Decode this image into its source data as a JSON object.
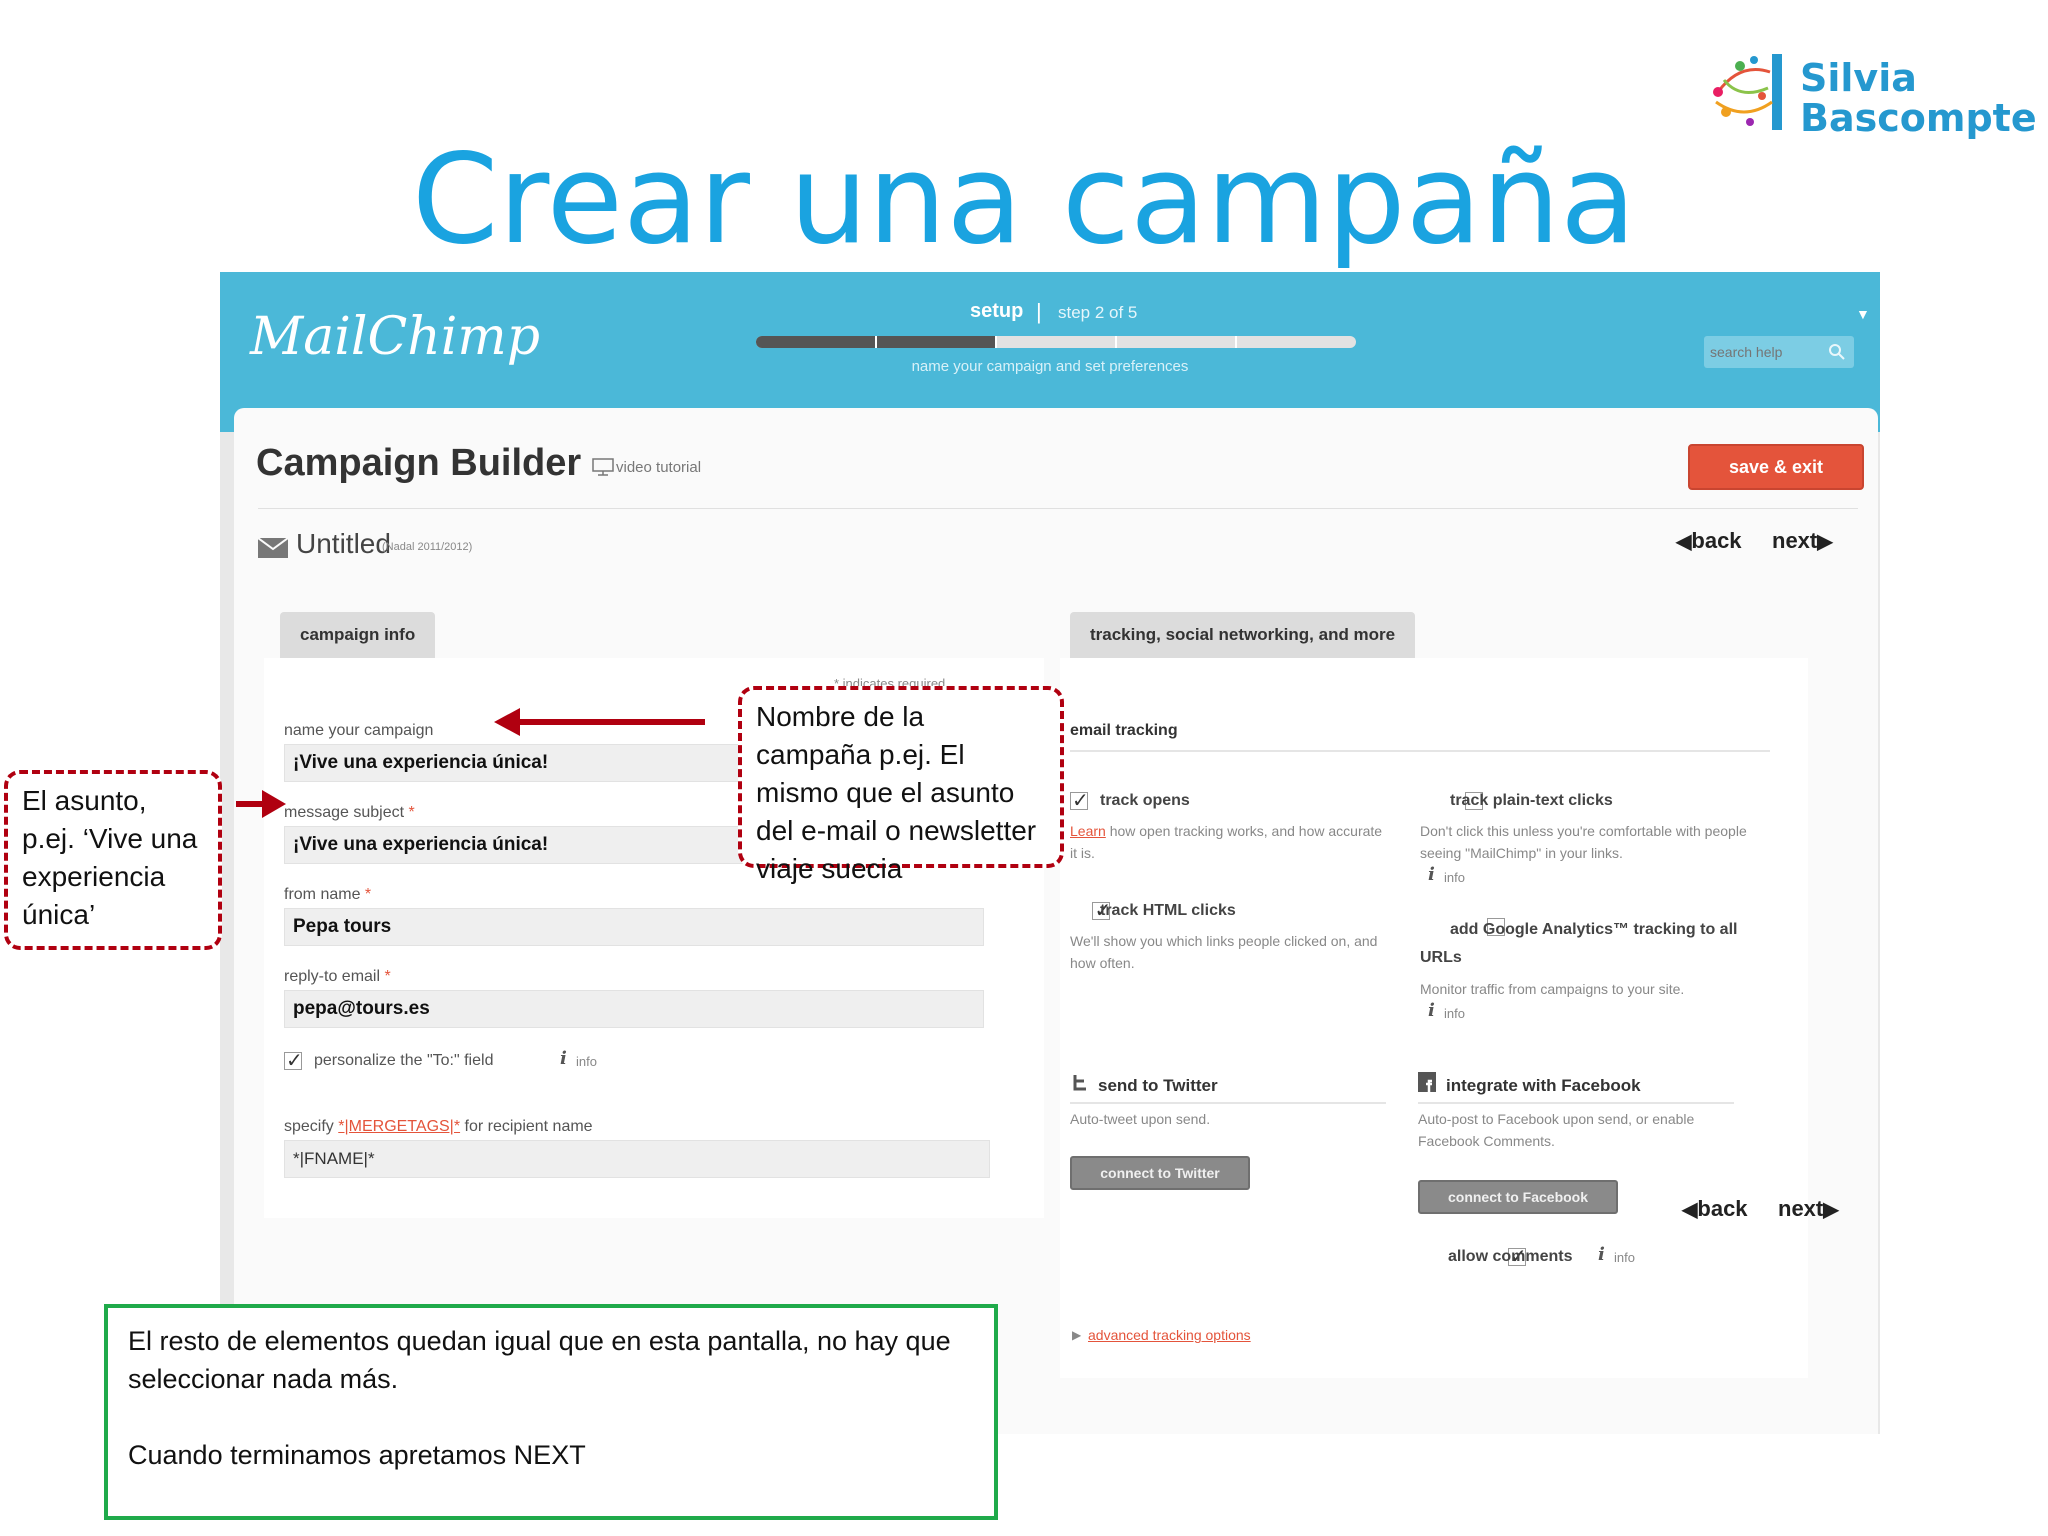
{
  "slide": {
    "title": "Crear una campaña",
    "logo": {
      "line1": "Silvia",
      "line2": "Bascompte"
    }
  },
  "app": {
    "brand": "MailChimp",
    "header": {
      "setup_label": "setup",
      "separator": "|",
      "step_label": "step 2 of 5",
      "progress": 0.4,
      "progress_steps": 5,
      "caption": "name your campaign and set preferences",
      "search_placeholder": "search help"
    },
    "page_title": "Campaign Builder",
    "video_label": "video tutorial",
    "save_exit_label": "save & exit",
    "campaign_name": "Untitled",
    "campaign_meta": "(Nadal 2011/2012)",
    "nav": {
      "back": "back",
      "next": "next"
    },
    "campaign_info": {
      "tab_label": "campaign info",
      "required_note": "* indicates required",
      "fields": {
        "name_label": "name your campaign",
        "name_value": "¡Vive una experiencia única!",
        "subject_label": "message subject",
        "subject_value": "¡Vive una experiencia única!",
        "from_label": "from name",
        "from_value": "Pepa tours",
        "reply_label": "reply-to email",
        "reply_value": "pepa@tours.es",
        "required_mark": "*"
      },
      "personalize_label": "personalize the \"To:\" field",
      "personalize_checked": true,
      "specify_prefix": "specify",
      "specify_link": "*|MERGETAGS|*",
      "specify_suffix": "for recipient name",
      "merge_value": "*|FNAME|*",
      "info_i": "i",
      "info_text": "info"
    },
    "tracking": {
      "tab_label": "tracking, social networking, and more",
      "section_title": "email tracking",
      "track_opens": {
        "label": "track opens",
        "checked": true,
        "link": "Learn",
        "help": "how open tracking works, and how accurate it is."
      },
      "track_html": {
        "label": "track HTML clicks",
        "checked": true,
        "help": "We'll show you which links people clicked on, and how often."
      },
      "track_plain": {
        "label": "track plain-text clicks",
        "checked": false,
        "help": "Don't click this unless you're comfortable with people seeing \"MailChimp\" in your links."
      },
      "google": {
        "label": "add Google Analytics™ tracking to all URLs",
        "checked": false,
        "help": "Monitor traffic from campaigns to your site."
      },
      "twitter": {
        "title": "send to Twitter",
        "help": "Auto-tweet upon send.",
        "button": "connect to Twitter"
      },
      "facebook": {
        "title": "integrate with Facebook",
        "help": "Auto-post to Facebook upon send, or enable Facebook Comments.",
        "button": "connect to Facebook"
      },
      "allow_comments": {
        "label": "allow comments",
        "checked": true
      },
      "advanced_link": "advanced tracking options",
      "info_text": "info"
    }
  },
  "annotations": {
    "subject_callout": "El asunto, p.ej. ‘Vive una experiencia única’",
    "name_callout": "Nombre de la campaña p.ej. El mismo que el asunto del e-mail o newsletter viaje suecia",
    "green_box_line1": "El resto de elementos quedan igual que en esta pantalla, no hay que seleccionar nada más.",
    "green_box_line2": "Cuando terminamos apretamos NEXT"
  },
  "colors": {
    "title_blue": "#1aa3e0",
    "header_teal": "#4bb8d8",
    "accent_orange": "#e4543b",
    "callout_red": "#b00010",
    "callout_green": "#1faa4a"
  }
}
